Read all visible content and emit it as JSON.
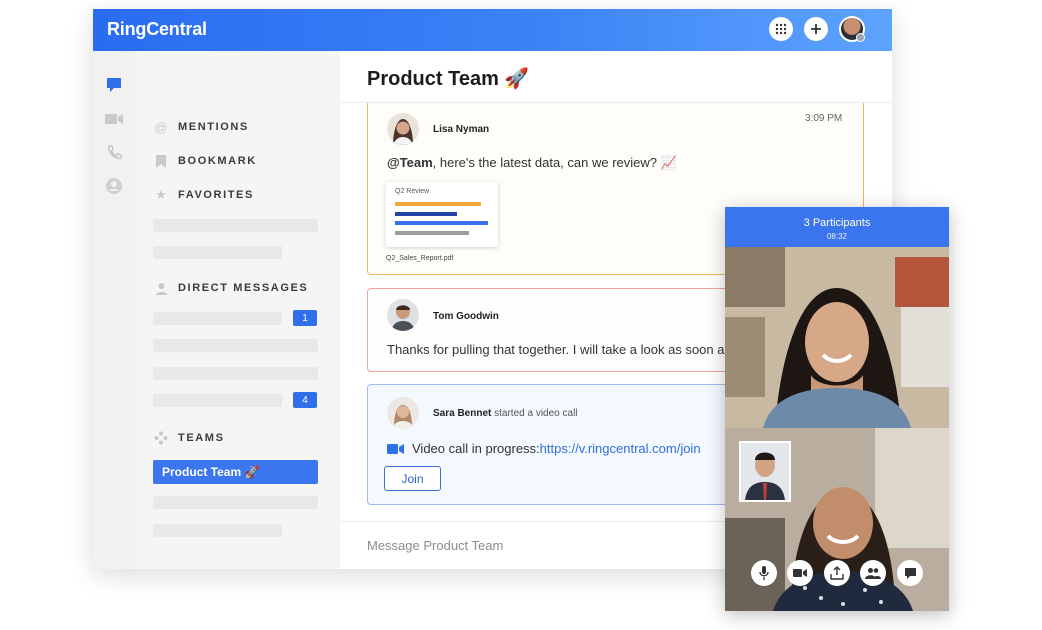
{
  "app": {
    "logo": "RingCentral"
  },
  "sidebar": {
    "mentions": "MENTIONS",
    "bookmark": "BOOKMARK",
    "favorites": "FAVORITES",
    "direct_messages": "DIRECT MESSAGES",
    "dm_badges": [
      "1",
      "4"
    ],
    "teams": "TEAMS",
    "selected_team": "Product Team 🚀"
  },
  "conversation": {
    "title": "Product Team 🚀",
    "messages": [
      {
        "author": "Lisa Nyman",
        "time": "3:09 PM",
        "mention": "@Team",
        "text": ", here's the latest data, can we review? 📈",
        "attachment_title": "Q2 Review",
        "attachment_file": "Q2_Sales_Report.pdf"
      },
      {
        "author": "Tom Goodwin",
        "text": "Thanks for pulling that together. I will take a look as soon as I can."
      },
      {
        "author": "Sara Bennet",
        "action": "started a video call",
        "text": "Video call in progress: ",
        "link": "https://v.ringcentral.com/join",
        "button": "Join"
      }
    ],
    "compose_placeholder": "Message Product Team"
  },
  "video_call": {
    "title": "3 Participants",
    "timer": "08:32"
  },
  "colors": {
    "brand": "#2a6cf0",
    "badge": "#2f6fea",
    "card1_border": "#f0b95a",
    "card2_border": "#f1a49a",
    "card3_border": "#9fbbef"
  }
}
